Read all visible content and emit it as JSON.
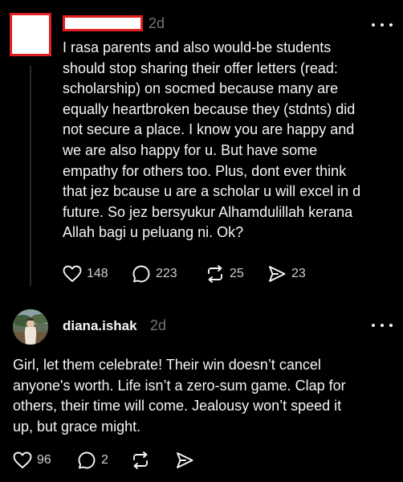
{
  "post1": {
    "username": "",
    "time": "2d",
    "text": "I rasa parents and also would-be students\nshould stop sharing their offer letters (read:\nscholarship) on socmed because many are\nequally heartbroken because they (stdnts) did\nnot secure a place. I know you are happy and\nwe are also happy for u. But have some\nempathy for others too. Plus, dont ever think\nthat jez bcause u are a scholar u will excel in d\nfuture. So jez bersyukur Alhamdulillah kerana\nAllah bagi u peluang ni. Ok?",
    "likes": "148",
    "comments": "223",
    "reposts": "25",
    "shares": "23"
  },
  "post2": {
    "username": "diana.ishak",
    "time": "2d",
    "text": "Girl, let them celebrate! Their win doesn’t cancel\nanyone's worth. Life isn’t a zero-sum game. Clap for\nothers, their time will come. Jealousy won’t speed it\nup, but grace might.",
    "likes": "96",
    "comments": "2"
  },
  "icons": {
    "like": "heart-icon",
    "comment": "comment-bubble-icon",
    "repost": "repost-arrows-icon",
    "share": "send-icon",
    "more": "more-options-icon"
  },
  "colors": {
    "background": "#000000",
    "text": "#f3f5f7",
    "secondary_text": "#777777",
    "redaction_border": "#e02020"
  }
}
